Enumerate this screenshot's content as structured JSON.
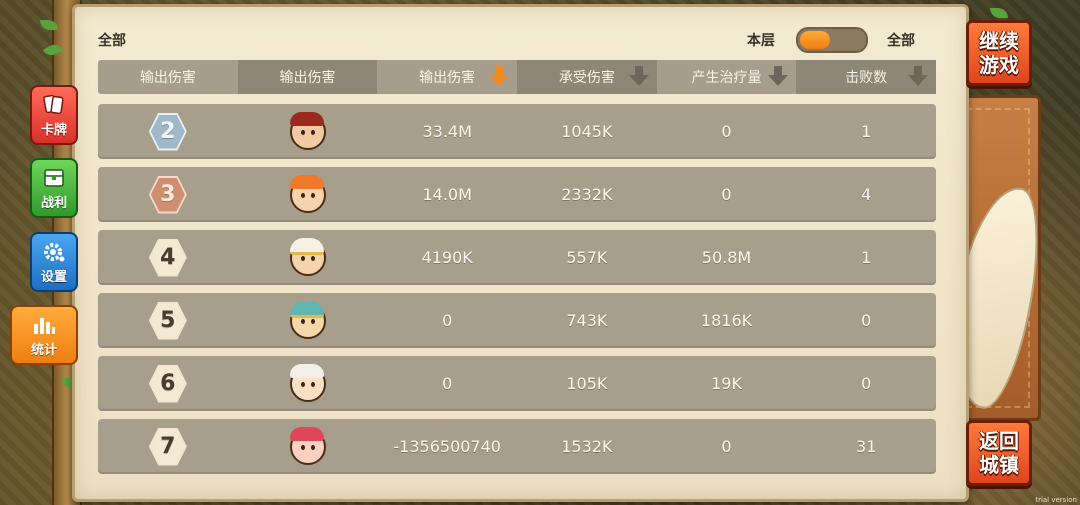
{
  "header": {
    "left_label": "全部",
    "toggle_left_label": "本层",
    "toggle_right_label": "全部"
  },
  "columns": [
    {
      "label": "输出伤害",
      "sort": "none"
    },
    {
      "label": "输出伤害",
      "sort": "none"
    },
    {
      "label": "输出伤害",
      "sort": "down-active"
    },
    {
      "label": "承受伤害",
      "sort": "down"
    },
    {
      "label": "产生治疗量",
      "sort": "down"
    },
    {
      "label": "击败数",
      "sort": "down"
    }
  ],
  "rows": [
    {
      "rank": "2",
      "rank_style": "silver",
      "avatar": "helmet-warrior-avatar",
      "damage": "33.4M",
      "taken": "1045K",
      "heal": "0",
      "kills": "1"
    },
    {
      "rank": "3",
      "rank_style": "bronze",
      "avatar": "orange-hair-avatar",
      "damage": "14.0M",
      "taken": "2332K",
      "heal": "0",
      "kills": "4"
    },
    {
      "rank": "4",
      "rank_style": "plain",
      "avatar": "white-priest-avatar",
      "damage": "4190K",
      "taken": "557K",
      "heal": "50.8M",
      "kills": "1"
    },
    {
      "rank": "5",
      "rank_style": "plain",
      "avatar": "crowned-king-avatar",
      "damage": "0",
      "taken": "743K",
      "heal": "1816K",
      "kills": "0"
    },
    {
      "rank": "6",
      "rank_style": "plain",
      "avatar": "white-hair-avatar",
      "damage": "0",
      "taken": "105K",
      "heal": "19K",
      "kills": "0"
    },
    {
      "rank": "7",
      "rank_style": "plain",
      "avatar": "red-hair-girl-avatar",
      "damage": "-1356500740",
      "taken": "1532K",
      "heal": "0",
      "kills": "31"
    }
  ],
  "left_tabs": [
    {
      "label": "卡牌",
      "icon": "cards-icon",
      "color": "red"
    },
    {
      "label": "战利",
      "icon": "chest-icon",
      "color": "green"
    },
    {
      "label": "设置",
      "icon": "gear-icon",
      "color": "blue"
    },
    {
      "label": "统计",
      "icon": "bar-chart-icon",
      "color": "orange"
    }
  ],
  "right_buttons": {
    "continue": {
      "line1": "继续",
      "line2": "游戏"
    },
    "return": {
      "line1": "返回",
      "line2": "城镇"
    }
  },
  "watermark": "trial version"
}
